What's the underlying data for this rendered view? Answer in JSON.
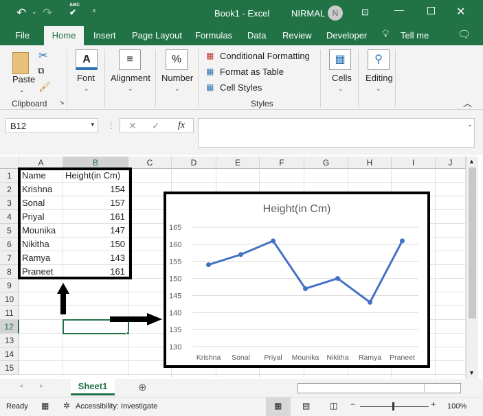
{
  "titlebar": {
    "title": "Book1  -  Excel",
    "user": "NIRMAL",
    "avatar_initial": "N",
    "spell_label": "ABC"
  },
  "tabs": [
    "File",
    "Home",
    "Insert",
    "Page Layout",
    "Formulas",
    "Data",
    "Review",
    "Developer"
  ],
  "tell_me": "Tell me",
  "ribbon": {
    "clipboard": {
      "paste": "Paste",
      "group": "Clipboard"
    },
    "font": "Font",
    "alignment": "Alignment",
    "number": "Number",
    "number_icon": "%",
    "styles": {
      "conditional": "Conditional Formatting",
      "format_table": "Format as Table",
      "cell_styles": "Cell Styles",
      "group": "Styles"
    },
    "cells": "Cells",
    "editing": "Editing",
    "font_icon": "A"
  },
  "formula_bar": {
    "name_box": "B12",
    "fx": "fx",
    "value": ""
  },
  "columns": [
    "A",
    "B",
    "C",
    "D",
    "E",
    "F",
    "G",
    "H",
    "I",
    "J"
  ],
  "rows": [
    "1",
    "2",
    "3",
    "4",
    "5",
    "6",
    "7",
    "8",
    "9",
    "10",
    "11",
    "12",
    "13",
    "14",
    "15"
  ],
  "table": {
    "headers": [
      "Name",
      "Height(in Cm)"
    ],
    "rows": [
      [
        "Krishna",
        "154"
      ],
      [
        "Sonal",
        "157"
      ],
      [
        "Priyal",
        "161"
      ],
      [
        "Mounika",
        "147"
      ],
      [
        "Nikitha",
        "150"
      ],
      [
        "Ramya",
        "143"
      ],
      [
        "Praneet",
        "161"
      ]
    ]
  },
  "selected_cell": "B12",
  "chart_data": {
    "type": "line",
    "title": "Height(in Cm)",
    "categories": [
      "Krishna",
      "Sonal",
      "Priyal",
      "Mounika",
      "Nikitha",
      "Ramya",
      "Praneet"
    ],
    "values": [
      154,
      157,
      161,
      147,
      150,
      143,
      161
    ],
    "ylim": [
      130,
      165
    ],
    "yticks": [
      130,
      135,
      140,
      145,
      150,
      155,
      160,
      165
    ],
    "grid": true,
    "color": "#4472c4"
  },
  "sheet_tab": "Sheet1",
  "status": {
    "ready": "Ready",
    "accessibility": "Accessibility: Investigate",
    "zoom": "100%"
  },
  "colors": {
    "brand": "#217346",
    "series": "#4472c4"
  }
}
